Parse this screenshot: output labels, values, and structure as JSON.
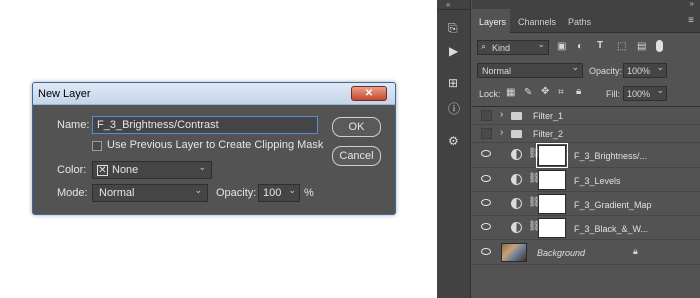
{
  "dialog": {
    "title": "New Layer",
    "close_label": "✕",
    "name_label": "Name:",
    "name_value": "F_3_Brightness/Contrast",
    "clip_label": "Use Previous Layer to Create Clipping Mask",
    "color_label": "Color:",
    "color_value": "None",
    "mode_label": "Mode:",
    "mode_value": "Normal",
    "opacity_label": "Opacity:",
    "opacity_value": "100",
    "opacity_unit": "%",
    "ok_label": "OK",
    "cancel_label": "Cancel"
  },
  "panel": {
    "tabs": [
      "Layers",
      "Channels",
      "Paths"
    ],
    "kind_label": "Kind",
    "blend_mode": "Normal",
    "opacity_label": "Opacity:",
    "opacity_value": "100%",
    "lock_label": "Lock:",
    "fill_label": "Fill:",
    "fill_value": "100%",
    "layers": [
      {
        "name": "Filter_1"
      },
      {
        "name": "Filter_2"
      },
      {
        "name": "F_3_Brightness/..."
      },
      {
        "name": "F_3_Levels"
      },
      {
        "name": "F_3_Gradient_Map"
      },
      {
        "name": "F_3_Black_&_W..."
      },
      {
        "name": "Background"
      }
    ]
  },
  "colors": {
    "dialog_bg": "#535353",
    "panel_bg": "#535353",
    "title_bar": "#c5d6ea",
    "close_button": "#c4482f",
    "focus_border": "#5b8bd0"
  }
}
